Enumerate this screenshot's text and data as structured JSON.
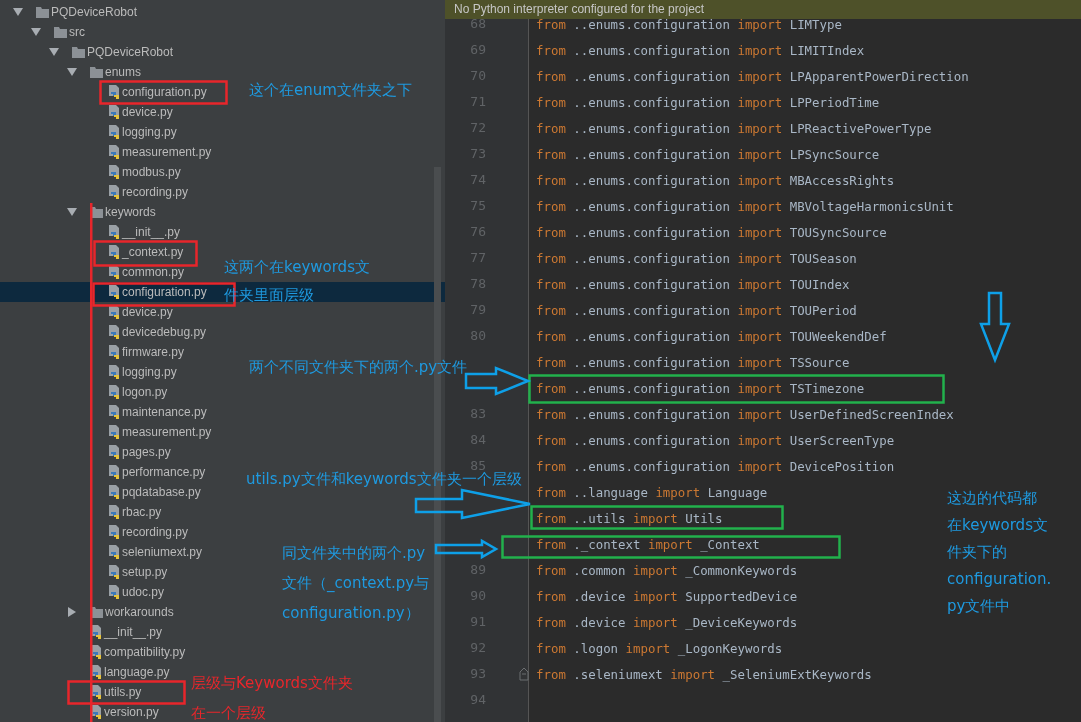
{
  "tree": [
    {
      "name": "PQDeviceRobot",
      "kind": "folder",
      "expanded": true,
      "selected": false,
      "children": [
        {
          "name": "src",
          "kind": "folder",
          "expanded": true,
          "selected": false,
          "children": [
            {
              "name": "PQDeviceRobot",
              "kind": "folder",
              "expanded": true,
              "selected": false,
              "children": [
                {
                  "name": "enums",
                  "kind": "folder",
                  "expanded": true,
                  "selected": false,
                  "children": [
                    {
                      "name": "configuration.py",
                      "kind": "file",
                      "selected": false
                    },
                    {
                      "name": "device.py",
                      "kind": "file",
                      "selected": false
                    },
                    {
                      "name": "logging.py",
                      "kind": "file",
                      "selected": false
                    },
                    {
                      "name": "measurement.py",
                      "kind": "file",
                      "selected": false
                    },
                    {
                      "name": "modbus.py",
                      "kind": "file",
                      "selected": false
                    },
                    {
                      "name": "recording.py",
                      "kind": "file",
                      "selected": false
                    }
                  ]
                },
                {
                  "name": "keywords",
                  "kind": "folder",
                  "expanded": true,
                  "selected": false,
                  "children": [
                    {
                      "name": "__init__.py",
                      "kind": "file",
                      "selected": false
                    },
                    {
                      "name": "_context.py",
                      "kind": "file",
                      "selected": false
                    },
                    {
                      "name": "common.py",
                      "kind": "file",
                      "selected": false
                    },
                    {
                      "name": "configuration.py",
                      "kind": "file",
                      "selected": true
                    },
                    {
                      "name": "device.py",
                      "kind": "file",
                      "selected": false
                    },
                    {
                      "name": "devicedebug.py",
                      "kind": "file",
                      "selected": false
                    },
                    {
                      "name": "firmware.py",
                      "kind": "file",
                      "selected": false
                    },
                    {
                      "name": "logging.py",
                      "kind": "file",
                      "selected": false
                    },
                    {
                      "name": "logon.py",
                      "kind": "file",
                      "selected": false
                    },
                    {
                      "name": "maintenance.py",
                      "kind": "file",
                      "selected": false
                    },
                    {
                      "name": "measurement.py",
                      "kind": "file",
                      "selected": false
                    },
                    {
                      "name": "pages.py",
                      "kind": "file",
                      "selected": false
                    },
                    {
                      "name": "performance.py",
                      "kind": "file",
                      "selected": false
                    },
                    {
                      "name": "pqdatabase.py",
                      "kind": "file",
                      "selected": false
                    },
                    {
                      "name": "rbac.py",
                      "kind": "file",
                      "selected": false
                    },
                    {
                      "name": "recording.py",
                      "kind": "file",
                      "selected": false
                    },
                    {
                      "name": "seleniumext.py",
                      "kind": "file",
                      "selected": false
                    },
                    {
                      "name": "setup.py",
                      "kind": "file",
                      "selected": false
                    },
                    {
                      "name": "udoc.py",
                      "kind": "file",
                      "selected": false
                    }
                  ]
                },
                {
                  "name": "workarounds",
                  "kind": "folder",
                  "expanded": false,
                  "selected": false
                },
                {
                  "name": "__init__.py",
                  "kind": "file",
                  "selected": false
                },
                {
                  "name": "compatibility.py",
                  "kind": "file",
                  "selected": false
                },
                {
                  "name": "language.py",
                  "kind": "file",
                  "selected": false
                },
                {
                  "name": "utils.py",
                  "kind": "file",
                  "selected": false
                },
                {
                  "name": "version.py",
                  "kind": "file",
                  "selected": false
                }
              ]
            }
          ]
        }
      ]
    }
  ],
  "editor": {
    "banner": "No Python interpreter configured for the project",
    "lines": [
      {
        "number": "68",
        "parts": [
          "from",
          "..enums.configuration",
          "import",
          "LIMType"
        ],
        "fold_marker": false
      },
      {
        "number": "69",
        "parts": [
          "from",
          "..enums.configuration",
          "import",
          "LIMITIndex"
        ],
        "fold_marker": false
      },
      {
        "number": "70",
        "parts": [
          "from",
          "..enums.configuration",
          "import",
          "LPApparentPowerDirection"
        ],
        "fold_marker": false
      },
      {
        "number": "71",
        "parts": [
          "from",
          "..enums.configuration",
          "import",
          "LPPeriodTime"
        ],
        "fold_marker": false
      },
      {
        "number": "72",
        "parts": [
          "from",
          "..enums.configuration",
          "import",
          "LPReactivePowerType"
        ],
        "fold_marker": false
      },
      {
        "number": "73",
        "parts": [
          "from",
          "..enums.configuration",
          "import",
          "LPSyncSource"
        ],
        "fold_marker": false
      },
      {
        "number": "74",
        "parts": [
          "from",
          "..enums.configuration",
          "import",
          "MBAccessRights"
        ],
        "fold_marker": false
      },
      {
        "number": "75",
        "parts": [
          "from",
          "..enums.configuration",
          "import",
          "MBVoltageHarmonicsUnit"
        ],
        "fold_marker": false
      },
      {
        "number": "76",
        "parts": [
          "from",
          "..enums.configuration",
          "import",
          "TOUSyncSource"
        ],
        "fold_marker": false
      },
      {
        "number": "77",
        "parts": [
          "from",
          "..enums.configuration",
          "import",
          "TOUSeason"
        ],
        "fold_marker": false
      },
      {
        "number": "78",
        "parts": [
          "from",
          "..enums.configuration",
          "import",
          "TOUIndex"
        ],
        "fold_marker": false
      },
      {
        "number": "79",
        "parts": [
          "from",
          "..enums.configuration",
          "import",
          "TOUPeriod"
        ],
        "fold_marker": false
      },
      {
        "number": "80",
        "parts": [
          "from",
          "..enums.configuration",
          "import",
          "TOUWeekendDef"
        ],
        "fold_marker": false
      },
      {
        "parts": [
          "from",
          "..enums.configuration",
          "import",
          "TSSource"
        ],
        "fold_marker": false
      },
      {
        "parts": [
          "from",
          "..enums.configuration",
          "import",
          "TSTimezone"
        ],
        "fold_marker": false
      },
      {
        "number": "83",
        "parts": [
          "from",
          "..enums.configuration",
          "import",
          "UserDefinedScreenIndex"
        ],
        "fold_marker": false
      },
      {
        "number": "84",
        "parts": [
          "from",
          "..enums.configuration",
          "import",
          "UserScreenType"
        ],
        "fold_marker": false
      },
      {
        "number": "85",
        "parts": [
          "from",
          "..enums.configuration",
          "import",
          "DevicePosition"
        ],
        "fold_marker": false
      },
      {
        "parts": [
          "from",
          "..language",
          "import",
          "Language"
        ],
        "fold_marker": false
      },
      {
        "parts": [
          "from",
          "..utils",
          "import",
          "Utils"
        ],
        "fold_marker": false
      },
      {
        "parts": [
          "from",
          "._context",
          "import",
          "_Context"
        ],
        "fold_marker": false
      },
      {
        "number": "89",
        "parts": [
          "from",
          ".common",
          "import",
          "_CommonKeywords"
        ],
        "fold_marker": false
      },
      {
        "number": "90",
        "parts": [
          "from",
          ".device",
          "import",
          "SupportedDevice"
        ],
        "fold_marker": false
      },
      {
        "number": "91",
        "parts": [
          "from",
          ".device",
          "import",
          "_DeviceKeywords"
        ],
        "fold_marker": false
      },
      {
        "number": "92",
        "parts": [
          "from",
          ".logon",
          "import",
          "_LogonKeywords"
        ],
        "fold_marker": false
      },
      {
        "number": "93",
        "parts": [
          "from",
          ".seleniumext",
          "import",
          "_SeleniumExtKeywords"
        ],
        "fold_marker": true
      },
      {
        "number": "94",
        "fold_marker": false
      }
    ]
  },
  "annotations": [
    {
      "lines": [
        "这个在enum文件夹之下"
      ],
      "color": "#1e9ae0"
    },
    {
      "lines": [
        "这两个在keywords文",
        "件夹里面层级"
      ],
      "color": "#1e9ae0"
    },
    {
      "lines": [
        "两个不同文件夹下的两个.py文件"
      ],
      "color": "#1e9ae0"
    },
    {
      "lines": [
        "utils.py文件和keywords文件夹一个层级"
      ],
      "color": "#1e9ae0"
    },
    {
      "lines": [
        "同文件夹中的两个.py",
        "文件（_context.py与",
        "configuration.py）"
      ],
      "color": "#1e9ae0"
    },
    {
      "lines": [
        "这边的代码都",
        "在keywords文",
        "件夹下的",
        "configuration.",
        "py文件中"
      ],
      "color": "#1e9ae0"
    },
    {
      "lines": [
        "层级与Keywords文件夹",
        "在一个层级"
      ],
      "color": "#e8262b"
    }
  ]
}
